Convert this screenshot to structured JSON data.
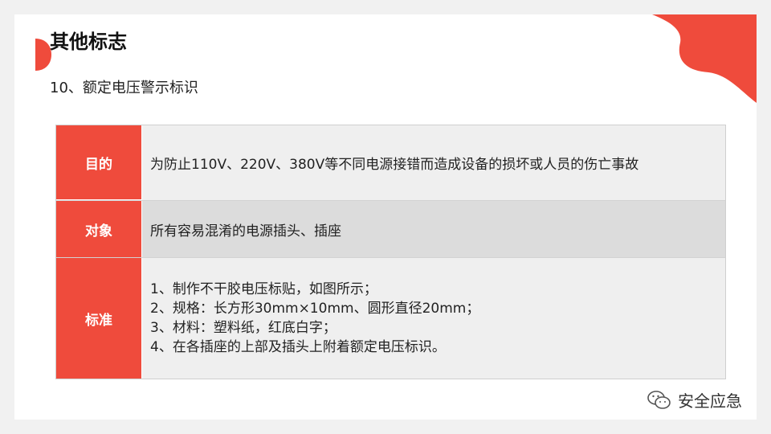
{
  "title": "其他标志",
  "subtitle": "10、额定电压警示标识",
  "table": {
    "rows": [
      {
        "label": "目的",
        "content": "为防止110V、220V、380V等不同电源接错而造成设备的损坏或人员的伤亡事故"
      },
      {
        "label": "对象",
        "content": "所有容易混淆的电源插头、插座"
      },
      {
        "label": "标准",
        "lines": [
          "1、制作不干胶电压标贴，如图所示；",
          "2、规格：长方形30mm×10mm、圆形直径20mm；",
          "3、材料：塑料纸，红底白字；",
          "4、在各插座的上部及插头上附着额定电压标识。"
        ]
      }
    ]
  },
  "watermark": {
    "text": "安全应急",
    "icon": "wechat-icon"
  },
  "colors": {
    "accent": "#ef4b3c",
    "row_light": "#efefef",
    "row_mid": "#dcdcdc"
  }
}
